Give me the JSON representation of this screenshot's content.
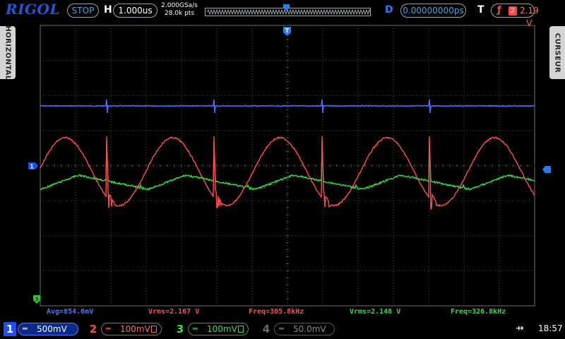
{
  "header": {
    "brand": "RIGOL",
    "run_state": "STOP",
    "timebase_label": "H",
    "timebase_value": "1.000us",
    "sample_rate": "2.000GSa/s",
    "memory_depth": "28.0k pts",
    "delay_label": "D",
    "delay_value": "0.00000000ps",
    "trigger_label": "T",
    "trigger_edge": "rising-edge-icon",
    "trigger_source": "2",
    "trigger_level": "2.19 V"
  },
  "side_tabs": {
    "left": "HORIZONTAL",
    "right": "CURSEUR"
  },
  "markers": {
    "ch1_ground": "1",
    "ch3_ground": "3",
    "trigger_position": "T"
  },
  "measurements": [
    {
      "text": "Avg=854.6mV",
      "channel": 1
    },
    {
      "text": "Vrms=2.167 V",
      "channel": 2
    },
    {
      "text": "Freq=305.8kHz",
      "channel": 2
    },
    {
      "text": "Vrms=2.148 V",
      "channel": 3
    },
    {
      "text": "Freq=326.8kHz",
      "channel": 3
    }
  ],
  "channels": [
    {
      "num": "1",
      "coupling": "═",
      "scale": "500mV",
      "color": "#4e78ff",
      "active": true
    },
    {
      "num": "2",
      "coupling": "═",
      "scale": "100mV",
      "color": "#ff4848",
      "active": true
    },
    {
      "num": "3",
      "coupling": "═",
      "scale": "100mV",
      "color": "#41e04a",
      "active": true
    },
    {
      "num": "4",
      "coupling": "═",
      "scale": "50.0mV",
      "color": "#888888",
      "active": false
    }
  ],
  "status": {
    "usb_icon": "usb-icon",
    "time": "18:57"
  },
  "colors": {
    "ch1": "#4e6bff",
    "ch2": "#ff5050",
    "ch3": "#33e040",
    "grid": "#505050",
    "brand": "#1f57d6"
  },
  "waveform": {
    "ch2_frequency_khz": 305.8,
    "ch3_frequency_khz": 326.8
  }
}
